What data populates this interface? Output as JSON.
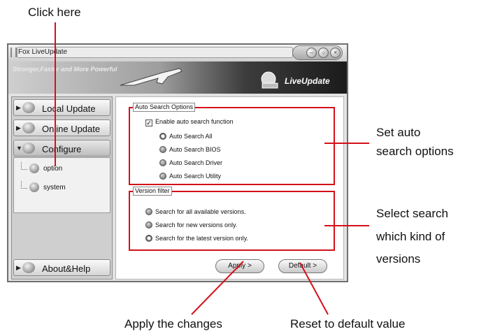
{
  "callouts": {
    "click_here": "Click here",
    "set_auto_line1": "Set auto",
    "set_auto_line2": "search options",
    "select_line1": "Select search",
    "select_line2": "which kind of",
    "select_line3": "versions",
    "apply_changes": "Apply the changes",
    "reset_default": "Reset to default value"
  },
  "window": {
    "title": "Fox LiveUpdate",
    "banner_tagline": "Stronger,Faster and More Powerful",
    "brand": "LiveUpdate"
  },
  "sidebar": {
    "items": [
      {
        "label": "Local Update",
        "icon": "local-update-icon"
      },
      {
        "label": "Online Update",
        "icon": "online-update-icon"
      },
      {
        "label": "Configure",
        "icon": "configure-icon"
      }
    ],
    "subitems": [
      {
        "label": "option",
        "icon": "gear-icon"
      },
      {
        "label": "system",
        "icon": "gear-icon"
      }
    ],
    "bottom": {
      "label": "About&Help",
      "icon": "help-icon"
    }
  },
  "auto_search": {
    "legend": "Auto Search Options",
    "enable_label": "Enable auto search function",
    "enable_checked": true,
    "options": [
      {
        "label": "Auto Search All",
        "selected": true
      },
      {
        "label": "Auto Search BIOS",
        "selected": false
      },
      {
        "label": "Auto Search Driver",
        "selected": false
      },
      {
        "label": "Auto Search Utility",
        "selected": false
      }
    ]
  },
  "version_filter": {
    "legend": "Version filter",
    "options": [
      {
        "label": "Search for all available versions.",
        "selected": false
      },
      {
        "label": "Search for new versions only.",
        "selected": false
      },
      {
        "label": "Search for the latest version only.",
        "selected": true
      }
    ]
  },
  "buttons": {
    "apply": "Apply >",
    "default": "Default >"
  },
  "colors": {
    "annotation_red": "#d4101a"
  }
}
